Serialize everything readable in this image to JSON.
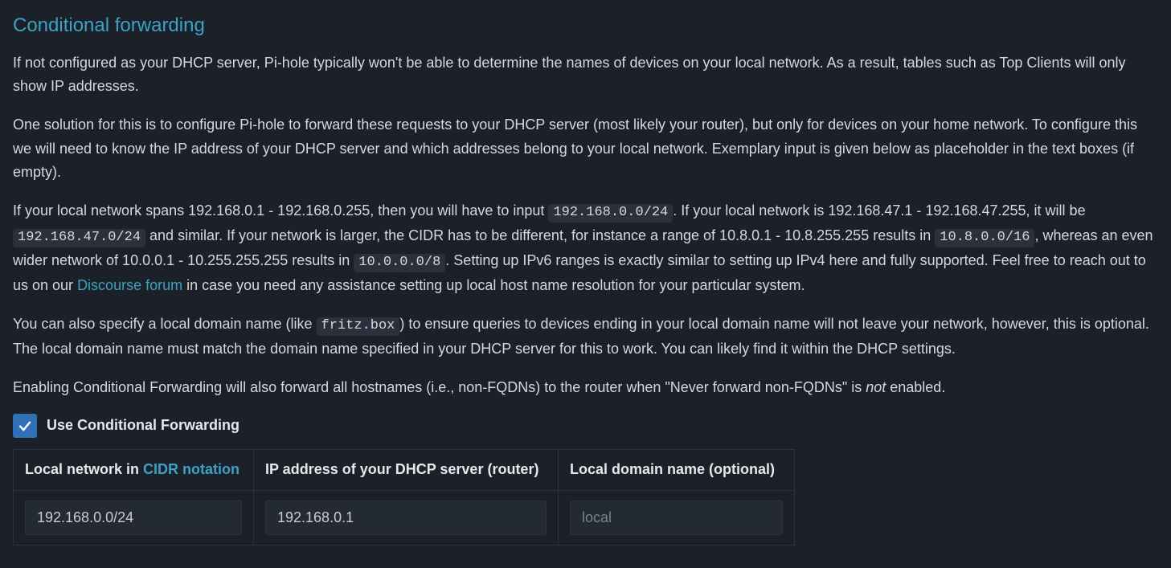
{
  "section": {
    "heading": "Conditional forwarding",
    "p1": "If not configured as your DHCP server, Pi-hole typically won't be able to determine the names of devices on your local network. As a result, tables such as Top Clients will only show IP addresses.",
    "p2": "One solution for this is to configure Pi-hole to forward these requests to your DHCP server (most likely your router), but only for devices on your home network. To configure this we will need to know the IP address of your DHCP server and which addresses belong to your local network. Exemplary input is given below as placeholder in the text boxes (if empty).",
    "p3": {
      "a": "If your local network spans 192.168.0.1 - 192.168.0.255, then you will have to input ",
      "code1": "192.168.0.0/24",
      "b": ". If your local network is 192.168.47.1 - 192.168.47.255, it will be ",
      "code2": "192.168.47.0/24",
      "c": " and similar. If your network is larger, the CIDR has to be different, for instance a range of 10.8.0.1 - 10.8.255.255 results in ",
      "code3": "10.8.0.0/16",
      "d": ", whereas an even wider network of 10.0.0.1 - 10.255.255.255 results in ",
      "code4": "10.0.0.0/8",
      "e": ". Setting up IPv6 ranges is exactly similar to setting up IPv4 here and fully supported. Feel free to reach out to us on our ",
      "link": "Discourse forum",
      "f": " in case you need any assistance setting up local host name resolution for your particular system."
    },
    "p4": {
      "a": "You can also specify a local domain name (like ",
      "code1": "fritz.box",
      "b": ") to ensure queries to devices ending in your local domain name will not leave your network, however, this is optional. The local domain name must match the domain name specified in your DHCP server for this to work. You can likely find it within the DHCP settings."
    },
    "p5": {
      "a": "Enabling Conditional Forwarding will also forward all hostnames (i.e., non-FQDNs) to the router when \"Never forward non-FQDNs\" is ",
      "em": "not",
      "b": " enabled."
    },
    "checkbox_label": "Use Conditional Forwarding",
    "checkbox_checked": true,
    "table": {
      "headers": {
        "network_pre": "Local network in ",
        "network_link": "CIDR notation",
        "dhcp": "IP address of your DHCP server (router)",
        "domain": "Local domain name (optional)"
      },
      "inputs": {
        "network": {
          "value": "192.168.0.0/24",
          "placeholder": ""
        },
        "dhcp": {
          "value": "192.168.0.1",
          "placeholder": ""
        },
        "domain": {
          "value": "",
          "placeholder": "local"
        }
      }
    }
  }
}
